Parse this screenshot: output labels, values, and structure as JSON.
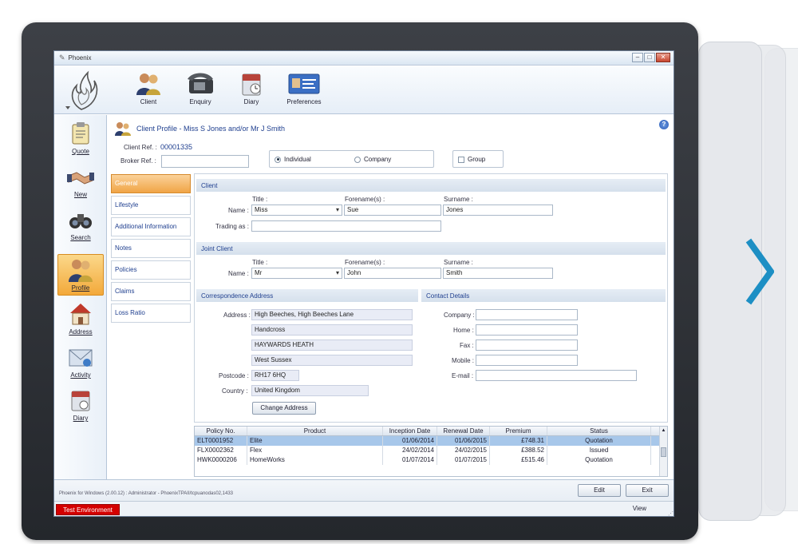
{
  "window": {
    "title": "Phoenix"
  },
  "ribbon": {
    "buttons": [
      {
        "label": "Client",
        "icon": "client-icon"
      },
      {
        "label": "Enquiry",
        "icon": "phone-icon"
      },
      {
        "label": "Diary",
        "icon": "diary-icon"
      },
      {
        "label": "Preferences",
        "icon": "preferences-icon"
      }
    ]
  },
  "leftnav": {
    "items": [
      {
        "label": "Quote",
        "icon": "clipboard-icon"
      },
      {
        "label": "New",
        "icon": "handshake-icon"
      },
      {
        "label": "Search",
        "icon": "binoculars-icon"
      },
      {
        "label": "Profile",
        "icon": "people-icon"
      },
      {
        "label": "Address",
        "icon": "house-icon"
      },
      {
        "label": "Activity",
        "icon": "envelope-icon"
      },
      {
        "label": "Diary",
        "icon": "calendar-icon"
      }
    ]
  },
  "profile": {
    "heading": "Client Profile - Miss S Jones and/or Mr J Smith",
    "client_ref_label": "Client Ref. :",
    "client_ref": "00001335",
    "broker_ref_label": "Broker Ref. :",
    "broker_ref": "",
    "individual_label": "Individual",
    "company_label": "Company",
    "group_label": "Group"
  },
  "tabs": [
    "General",
    "Lifestyle",
    "Additional Information",
    "Notes",
    "Policies",
    "Claims",
    "Loss Ratio"
  ],
  "client": {
    "section": "Client",
    "title_label": "Title :",
    "forename_label": "Forename(s) :",
    "surname_label": "Surname :",
    "name_label": "Name :",
    "title": "Miss",
    "forename": "Sue",
    "surname": "Jones",
    "trading_label": "Trading as :",
    "trading": ""
  },
  "joint": {
    "section": "Joint Client",
    "title_label": "Title :",
    "forename_label": "Forename(s) :",
    "surname_label": "Surname :",
    "name_label": "Name :",
    "title": "Mr",
    "forename": "John",
    "surname": "Smith"
  },
  "address": {
    "section": "Correspondence Address",
    "address_label": "Address :",
    "lines": [
      "High Beeches, High Beeches Lane",
      "Handcross",
      "HAYWARDS HEATH",
      "West Sussex"
    ],
    "postcode_label": "Postcode :",
    "postcode": "RH17 6HQ",
    "country_label": "Country :",
    "country": "United Kingdom",
    "change_button": "Change Address"
  },
  "contact": {
    "section": "Contact Details",
    "company_label": "Company :",
    "home_label": "Home :",
    "fax_label": "Fax :",
    "mobile_label": "Mobile :",
    "email_label": "E-mail :"
  },
  "policies": {
    "headers": [
      "Policy No.",
      "Product",
      "Inception Date",
      "Renewal Date",
      "Premium",
      "Status"
    ],
    "rows": [
      [
        "ELT0001952",
        "Elite",
        "01/06/2014",
        "01/06/2015",
        "£748.31",
        "Quotation"
      ],
      [
        "FLX0002362",
        "Flex",
        "24/02/2014",
        "24/02/2015",
        "£388.52",
        "Issued"
      ],
      [
        "HWK0000206",
        "HomeWorks",
        "01/07/2014",
        "01/07/2015",
        "£515.46",
        "Quotation"
      ]
    ]
  },
  "footer": {
    "version": "Phoenix for Windows (2.00.12) : Administrator - PhoenixTPAII/tcpuanodas02,1433",
    "edit_button": "Edit",
    "exit_button": "Exit",
    "environment": "Test Environment",
    "view": "View"
  },
  "colors": {
    "accent": "#1f3f8f",
    "active_tab": "#f0a446",
    "environment": "#d40000",
    "arrow": "#1d8fc4"
  }
}
